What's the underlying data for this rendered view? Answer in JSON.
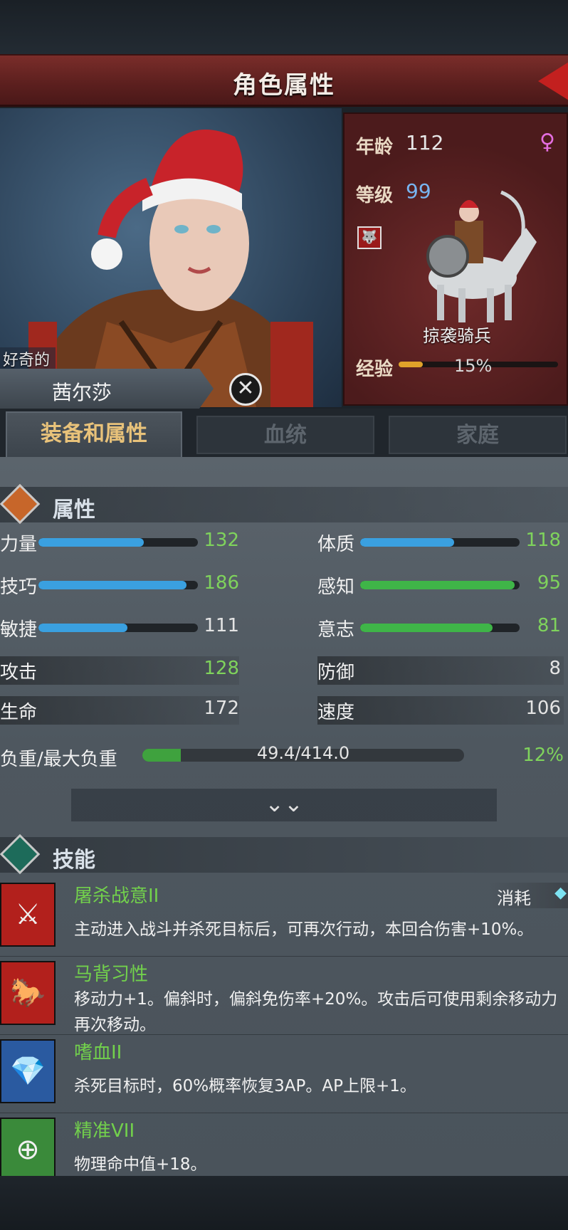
{
  "header": {
    "title": "角色属性"
  },
  "character": {
    "trait": "好奇的",
    "name": "茜尔莎",
    "age_label": "年龄",
    "age": "112",
    "level_label": "等级",
    "level": "99",
    "unit_type": "掠袭骑兵",
    "exp_label": "经验",
    "exp_percent": "15%",
    "exp_fraction": 0.15
  },
  "tabs": [
    "装备和属性",
    "血统",
    "家庭"
  ],
  "attributes": {
    "header": "属性",
    "stats": [
      {
        "label": "力量",
        "value": "132",
        "fraction": 0.66
      },
      {
        "label": "体质",
        "value": "118",
        "fraction": 0.59
      },
      {
        "label": "技巧",
        "value": "186",
        "fraction": 0.93
      },
      {
        "label": "感知",
        "value": "95",
        "fraction": 0.97
      },
      {
        "label": "敏捷",
        "value": "111",
        "fraction": 0.56
      },
      {
        "label": "意志",
        "value": "81",
        "fraction": 0.83
      }
    ],
    "plain": [
      {
        "label": "攻击",
        "value": "128"
      },
      {
        "label": "防御",
        "value": "8"
      },
      {
        "label": "生命",
        "value": "172"
      },
      {
        "label": "速度",
        "value": "106"
      }
    ],
    "load_label": "负重/最大负重",
    "load_value": "49.4/414.0",
    "load_percent": "12%",
    "load_fraction": 0.12
  },
  "skills": {
    "header": "技能",
    "cost_label": "消耗",
    "items": [
      {
        "name": "屠杀战意II",
        "desc": "主动进入战斗并杀死目标后，可再次行动，本回合伤害+10%。"
      },
      {
        "name": "马背习性",
        "desc": "移动力+1。偏斜时，偏斜免伤率+20%。攻击后可使用剩余移动力再次移动。"
      },
      {
        "name": "嗜血II",
        "desc": "杀死目标时，60%概率恢复3AP。AP上限+1。"
      },
      {
        "name": "精准VII",
        "desc": "物理命中值+18。"
      }
    ]
  },
  "colors": {
    "str_bar": "#3aa0e0",
    "green_bar": "#3fb548",
    "value_green": "#7fd35c"
  }
}
